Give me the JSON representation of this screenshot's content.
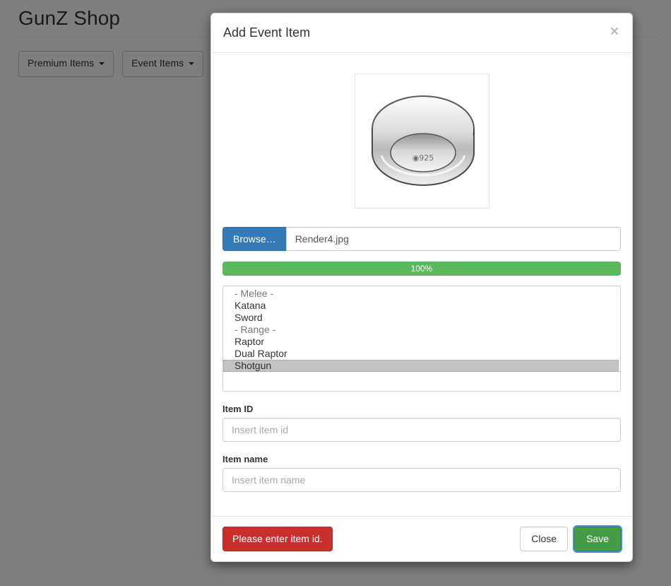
{
  "page": {
    "title": "GunZ Shop",
    "toolbar": [
      {
        "label": "Premium Items",
        "icon": "caret-down-icon"
      },
      {
        "label": "Event Items",
        "icon": "caret-down-icon"
      }
    ]
  },
  "modal": {
    "title": "Add Event Item",
    "close_label": "×",
    "preview": {
      "alt": "silver-ring-celtic-pattern",
      "stamp": "925"
    },
    "file_input": {
      "browse_label": "Browse…",
      "file_name": "Render4.jpg"
    },
    "progress": {
      "label": "100%",
      "percent": 100,
      "color": "#5cb85c"
    },
    "item_list": {
      "options": [
        {
          "label": "- Melee -",
          "group": true,
          "selected": false
        },
        {
          "label": "Katana",
          "group": false,
          "selected": false
        },
        {
          "label": "Sword",
          "group": false,
          "selected": false
        },
        {
          "label": "- Range -",
          "group": true,
          "selected": false
        },
        {
          "label": "Raptor",
          "group": false,
          "selected": false
        },
        {
          "label": "Dual Raptor",
          "group": false,
          "selected": false
        },
        {
          "label": "Shotgun",
          "group": false,
          "selected": true
        }
      ]
    },
    "fields": [
      {
        "label": "Item ID",
        "value": "",
        "placeholder": "Insert item id",
        "name": "item-id"
      },
      {
        "label": "Item name",
        "value": "",
        "placeholder": "Insert item name",
        "name": "item-name"
      }
    ],
    "footer": {
      "alert_label": "Please enter item id.",
      "alert_color": "#c9302c",
      "close_label": "Close",
      "save_label": "Save",
      "save_color": "#449d44"
    }
  }
}
